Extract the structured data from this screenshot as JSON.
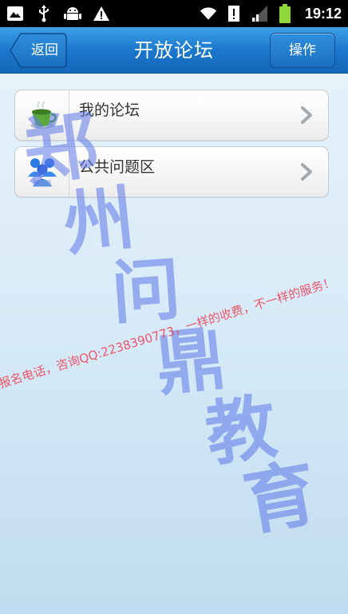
{
  "status_bar": {
    "time": "19:12",
    "icons_left": [
      "screenshot-icon",
      "usb-icon",
      "android-debug-icon",
      "warning-icon"
    ],
    "icons_right": [
      "wifi-icon",
      "alert-icon",
      "signal-icon",
      "battery-icon"
    ]
  },
  "header": {
    "title": "开放论坛",
    "back_label": "返回",
    "action_label": "操作"
  },
  "forum_list": {
    "items": [
      {
        "label": "我的论坛",
        "icon": "tea-cup-icon"
      },
      {
        "label": "公共问题区",
        "icon": "people-group-icon"
      }
    ]
  },
  "watermark": {
    "characters": [
      "郑",
      "州",
      "问",
      "鼎",
      "教",
      "育"
    ],
    "line": "报名电话，咨询QQ:2238390773，一样的收费，不一样的服务！"
  },
  "colors": {
    "title_bar": "#1b78cd",
    "status_bar": "#000000",
    "battery": "#8fd63a",
    "watermark_blue": "#5c76e8",
    "watermark_red": "#f0465a"
  }
}
